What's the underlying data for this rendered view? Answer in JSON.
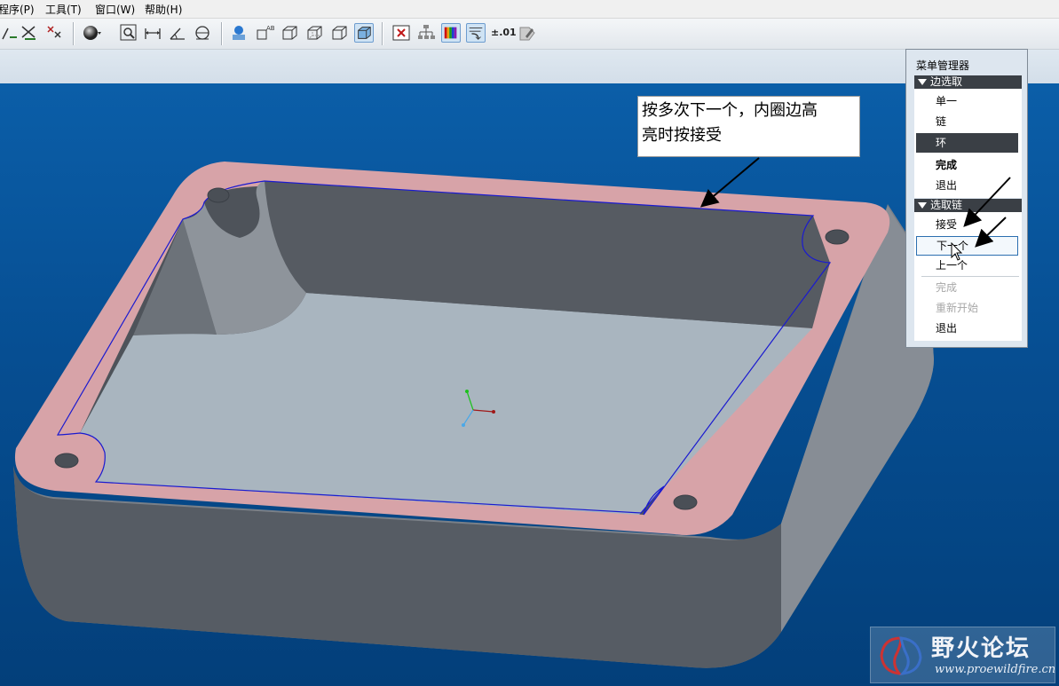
{
  "menubar": {
    "items": [
      "程序(P)",
      "工具(T)",
      "窗口(W)",
      "帮助(H)"
    ]
  },
  "toolbar": {
    "icons": [
      "sketch-constraint-icon",
      "trim-icon",
      "delete-segment-icon",
      "shading-sphere-icon",
      "zoom-fit-icon",
      "dimension-icon",
      "angle-dimension-icon",
      "radius-dimension-icon",
      "datum-display-icon",
      "annotation-icon",
      "wireframe-icon",
      "hidden-line-icon",
      "no-hidden-icon",
      "shaded-icon",
      "close-window-icon",
      "model-tree-icon",
      "color-appearance-icon",
      "regenerate-icon",
      "tolerance-icon",
      "edit-icon"
    ],
    "tolerance_label": "±.01"
  },
  "callout": {
    "line1": "按多次下一个，内圈边高",
    "line2": "亮时按接受"
  },
  "menu_manager": {
    "title": "菜单管理器",
    "section1": {
      "label": "边选取",
      "items": [
        "单一",
        "链",
        "环",
        "完成",
        "退出"
      ]
    },
    "section2": {
      "label": "选取链",
      "items": [
        "接受",
        "下一个",
        "上一个",
        "完成",
        "重新开始",
        "退出"
      ]
    }
  },
  "watermark": {
    "title": "野火论坛",
    "url": "www.proewildfire.cn"
  },
  "colors": {
    "face_highlight": "#d7a3a8",
    "edge_highlight": "#1a1ad0",
    "viewport_top": "#0b5ea8",
    "menu_selected": "#3a3f45"
  }
}
